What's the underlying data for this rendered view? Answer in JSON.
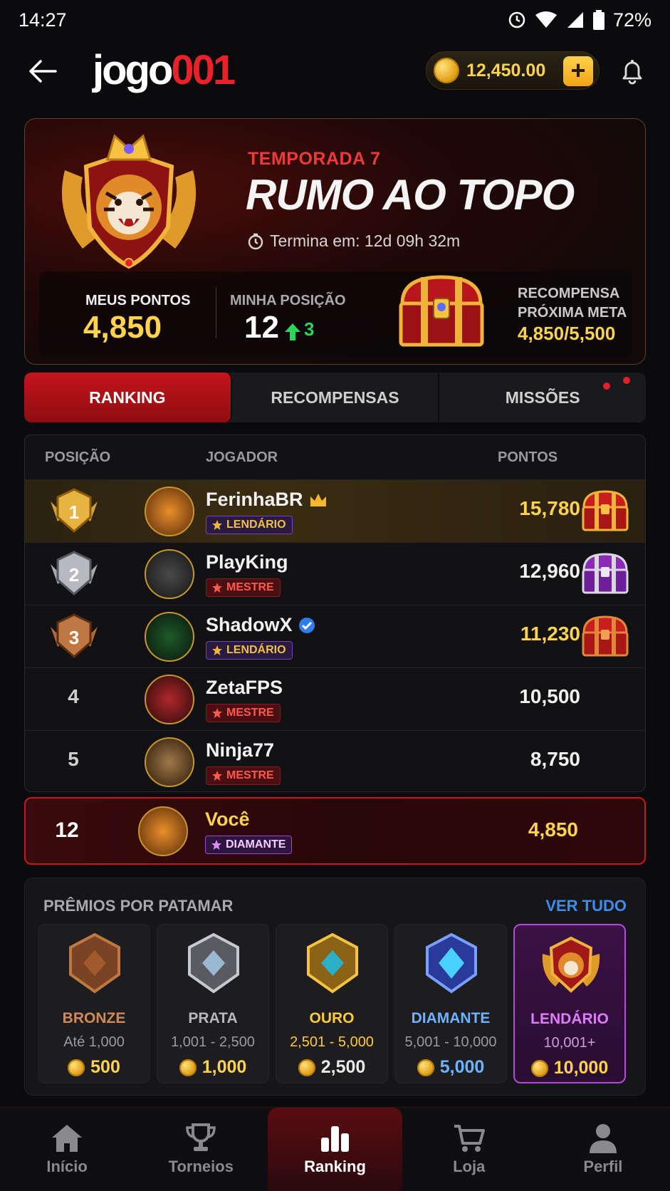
{
  "status_bar": {
    "time": "14:27",
    "battery": "72%"
  },
  "header": {
    "logo_part1": "jogo",
    "logo_part2": "001",
    "balance": "12,450.00",
    "add_label": "+"
  },
  "season": {
    "label": "TEMPORADA 7",
    "title": "RUMO AO TOPO",
    "timer": "Termina em: 12d 09h 32m",
    "my_points_label": "MEUS PONTOS",
    "my_points": "4,850",
    "my_position_label": "MINHA POSIÇÃO",
    "my_position": "12",
    "position_change": "3",
    "reward_label_1": "RECOMPENSA",
    "reward_label_2": "PRÓXIMA META",
    "reward_progress": "4,850/5,500"
  },
  "tabs": [
    {
      "label": "RANKING",
      "active": true
    },
    {
      "label": "RECOMPENSAS",
      "active": false
    },
    {
      "label": "MISSÕES",
      "active": false
    }
  ],
  "table": {
    "headers": {
      "position": "POSIÇÃO",
      "player": "JOGADOR",
      "points": "PONTOS"
    },
    "rows": [
      {
        "rank": "1",
        "name": "FerinhaBR",
        "badge": "LENDÁRIO",
        "points": "15,780"
      },
      {
        "rank": "2",
        "name": "PlayKing",
        "badge": "MESTRE",
        "points": "12,960"
      },
      {
        "rank": "3",
        "name": "ShadowX",
        "badge": "LENDÁRIO",
        "points": "11,230"
      },
      {
        "rank": "4",
        "name": "ZetaFPS",
        "badge": "MESTRE",
        "points": "10,500"
      },
      {
        "rank": "5",
        "name": "Ninja77",
        "badge": "MESTRE",
        "points": "8,750"
      }
    ],
    "you": {
      "rank": "12",
      "name": "Você",
      "badge": "DIAMANTE",
      "points": "4,850"
    }
  },
  "tiers": {
    "title": "PRÊMIOS POR PATAMAR",
    "view_all": "VER TUDO",
    "items": [
      {
        "name": "BRONZE",
        "range": "Até 1,000",
        "prize": "500",
        "color": "#d08a5a"
      },
      {
        "name": "PRATA",
        "range": "1,001 - 2,500",
        "prize": "1,000",
        "color": "#b8b8bc"
      },
      {
        "name": "OURO",
        "range": "2,501 - 5,000",
        "prize": "2,500",
        "color": "#ffc93a"
      },
      {
        "name": "DIAMANTE",
        "range": "5,001 - 10,000",
        "prize": "5,000",
        "color": "#6fb2ff"
      },
      {
        "name": "LENDÁRIO",
        "range": "10,001+",
        "prize": "10,000",
        "color": "#e07bff"
      }
    ]
  },
  "nav": [
    {
      "label": "Início",
      "icon": "home-icon"
    },
    {
      "label": "Torneios",
      "icon": "trophy-icon"
    },
    {
      "label": "Ranking",
      "icon": "ranking-icon",
      "active": true
    },
    {
      "label": "Loja",
      "icon": "cart-icon"
    },
    {
      "label": "Perfil",
      "icon": "profile-icon"
    }
  ]
}
